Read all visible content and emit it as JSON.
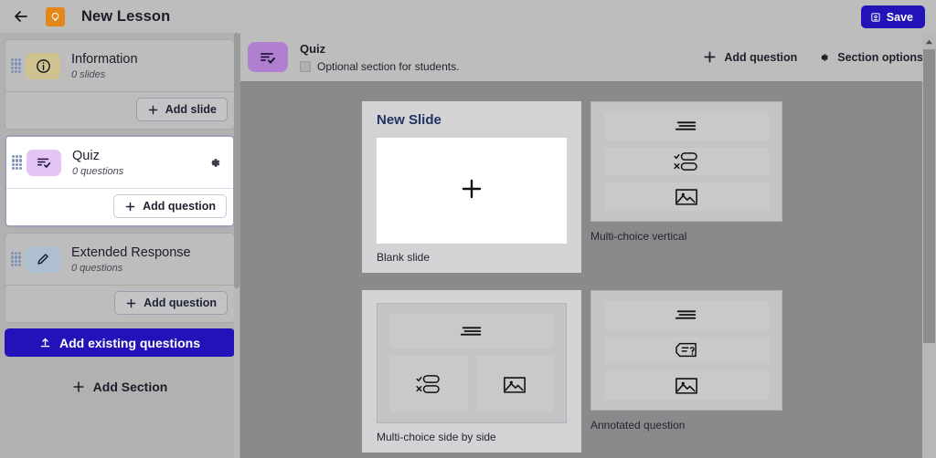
{
  "topbar": {
    "back_icon": "back-arrow-icon",
    "brand_icon": "lightbulb-icon",
    "title": "New Lesson",
    "save_label": "Save",
    "save_icon": "save-document-icon",
    "save_color": "#2312b8",
    "brand_color": "#e3871a",
    "bar_color": "#bdbdbd"
  },
  "sidebar": {
    "sections": [
      {
        "name": "Information",
        "subtitle": "0 slides",
        "icon": "info-circle-icon",
        "icon_color": "#cec28f",
        "action_label": "Add slide",
        "selected": false,
        "has_gear": false
      },
      {
        "name": "Quiz",
        "subtitle": "0 questions",
        "icon": "quiz-checklist-icon",
        "icon_color": "#e5c5f5",
        "action_label": "Add question",
        "selected": true,
        "has_gear": true,
        "gear_icon": "gear-icon"
      },
      {
        "name": "Extended Response",
        "subtitle": "0 questions",
        "icon": "pencil-icon",
        "icon_color": "#aec0cf",
        "action_label": "Add question",
        "selected": false,
        "has_gear": false
      }
    ],
    "add_existing_label": "Add existing questions",
    "add_existing_icon": "upload-icon",
    "add_section_label": "Add Section",
    "add_section_icon": "plus-icon"
  },
  "main": {
    "header": {
      "icon": "quiz-checklist-icon",
      "icon_color": "#b07fd0",
      "title": "Quiz",
      "optional_label": "Optional section for students.",
      "optional_checked": false,
      "add_question_label": "Add question",
      "add_question_icon": "plus-icon",
      "section_options_label": "Section options",
      "section_options_icon": "gear-icon"
    },
    "new_slide": {
      "title": "New Slide",
      "blank_label": "Blank slide",
      "blank_icon": "plus-icon"
    },
    "templates": [
      {
        "label": "Multi-choice vertical",
        "layout": "vertical",
        "rows": [
          "text-lines-icon",
          "multi-choice-options-icon",
          "image-icon"
        ]
      },
      {
        "label": "Multi-choice side by side",
        "layout": "side-by-side",
        "rows": [
          "text-lines-icon"
        ],
        "split_rows": [
          "multi-choice-options-icon",
          "image-icon"
        ]
      },
      {
        "label": "Annotated question",
        "layout": "vertical",
        "rows": [
          "text-lines-icon",
          "speech-bubble-question-icon",
          "image-icon"
        ]
      }
    ],
    "canvas_color": "#8a8a8c",
    "card_color": "#d3d3d6",
    "card_title_color": "#1f3360"
  }
}
